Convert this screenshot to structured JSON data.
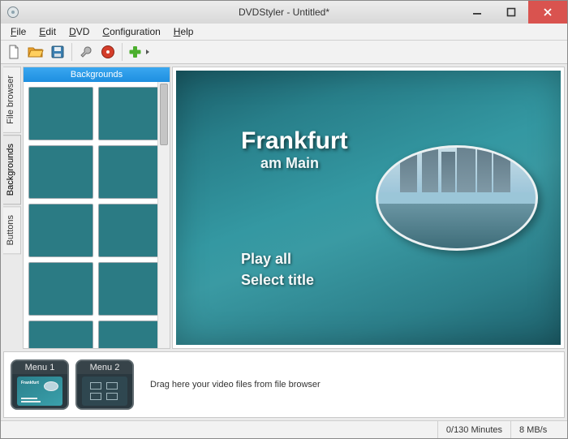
{
  "window": {
    "title": "DVDStyler - Untitled*"
  },
  "menubar": {
    "file": "File",
    "file_u": "F",
    "edit": "Edit",
    "edit_u": "E",
    "dvd": "DVD",
    "dvd_u": "D",
    "config": "Configuration",
    "config_u": "C",
    "help": "Help",
    "help_u": "H"
  },
  "toolbar_icons": {
    "new": "new-file-icon",
    "open": "open-folder-icon",
    "save": "save-icon",
    "options": "wrench-icon",
    "burn": "burn-disc-icon",
    "add": "add-plus-icon"
  },
  "sidetabs": {
    "file_browser": "File browser",
    "backgrounds": "Backgrounds",
    "buttons": "Buttons"
  },
  "bgpanel": {
    "header": "Backgrounds"
  },
  "dvdmenu": {
    "title1": "Frankfurt",
    "title2": "am Main",
    "play_all": "Play all",
    "select_title": "Select title"
  },
  "timeline": {
    "menu1": "Menu 1",
    "menu2": "Menu 2",
    "hint": "Drag here your video files from file browser"
  },
  "statusbar": {
    "duration": "0/130 Minutes",
    "rate": "8 MB/s"
  }
}
